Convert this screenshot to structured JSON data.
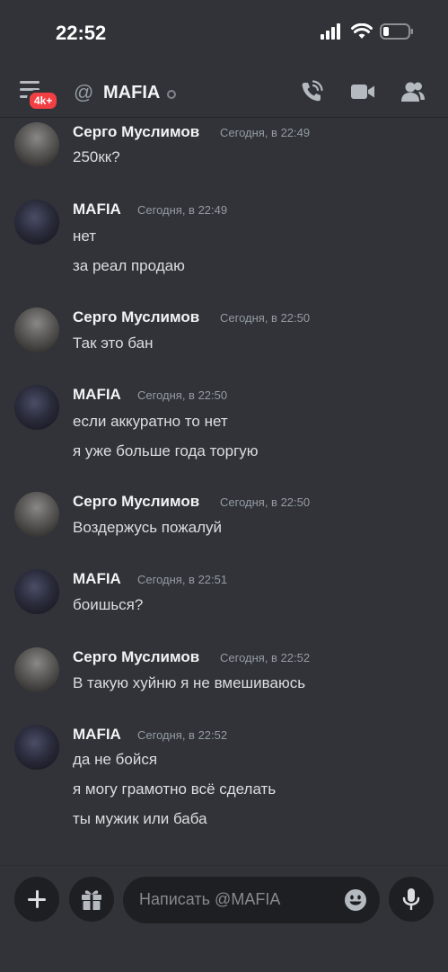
{
  "status": {
    "time": "22:52"
  },
  "header": {
    "badge": "4k+",
    "at_symbol": "@",
    "title": "MAFIA"
  },
  "messages": [
    {
      "author": "Серго Муслимов",
      "timestamp": "Сегодня, в 22:49",
      "avatar": "sergo",
      "lines": [
        "250кк?"
      ]
    },
    {
      "author": "MAFIA",
      "timestamp": "Сегодня, в 22:49",
      "avatar": "mafia",
      "lines": [
        "нет",
        "за реал продаю"
      ]
    },
    {
      "author": "Серго Муслимов",
      "timestamp": "Сегодня, в 22:50",
      "avatar": "sergo",
      "lines": [
        "Так это бан"
      ]
    },
    {
      "author": "MAFIA",
      "timestamp": "Сегодня, в 22:50",
      "avatar": "mafia",
      "lines": [
        "если аккуратно то нет",
        "я уже больше года торгую"
      ]
    },
    {
      "author": "Серго Муслимов",
      "timestamp": "Сегодня, в 22:50",
      "avatar": "sergo",
      "lines": [
        "Воздержусь пожалуй"
      ]
    },
    {
      "author": "MAFIA",
      "timestamp": "Сегодня, в 22:51",
      "avatar": "mafia",
      "lines": [
        "боишься?"
      ]
    },
    {
      "author": "Серго Муслимов",
      "timestamp": "Сегодня, в 22:52",
      "avatar": "sergo",
      "lines": [
        "В такую хуйню я не вмешиваюсь"
      ]
    },
    {
      "author": "MAFIA",
      "timestamp": "Сегодня, в 22:52",
      "avatar": "mafia",
      "lines": [
        "да не бойся",
        "я могу грамотно всё сделать",
        "ты мужик или баба"
      ]
    }
  ],
  "composer": {
    "placeholder": "Написать @MAFIA"
  },
  "icons": {
    "menu": "hamburger-icon",
    "call": "phone-call-icon",
    "video": "video-camera-icon",
    "members": "members-icon",
    "add": "plus-icon",
    "gift": "gift-icon",
    "emoji": "emoji-icon",
    "mic": "microphone-icon"
  },
  "colors": {
    "background": "#313338",
    "badge": "#f23f43",
    "input_bg": "#1e1f22"
  }
}
